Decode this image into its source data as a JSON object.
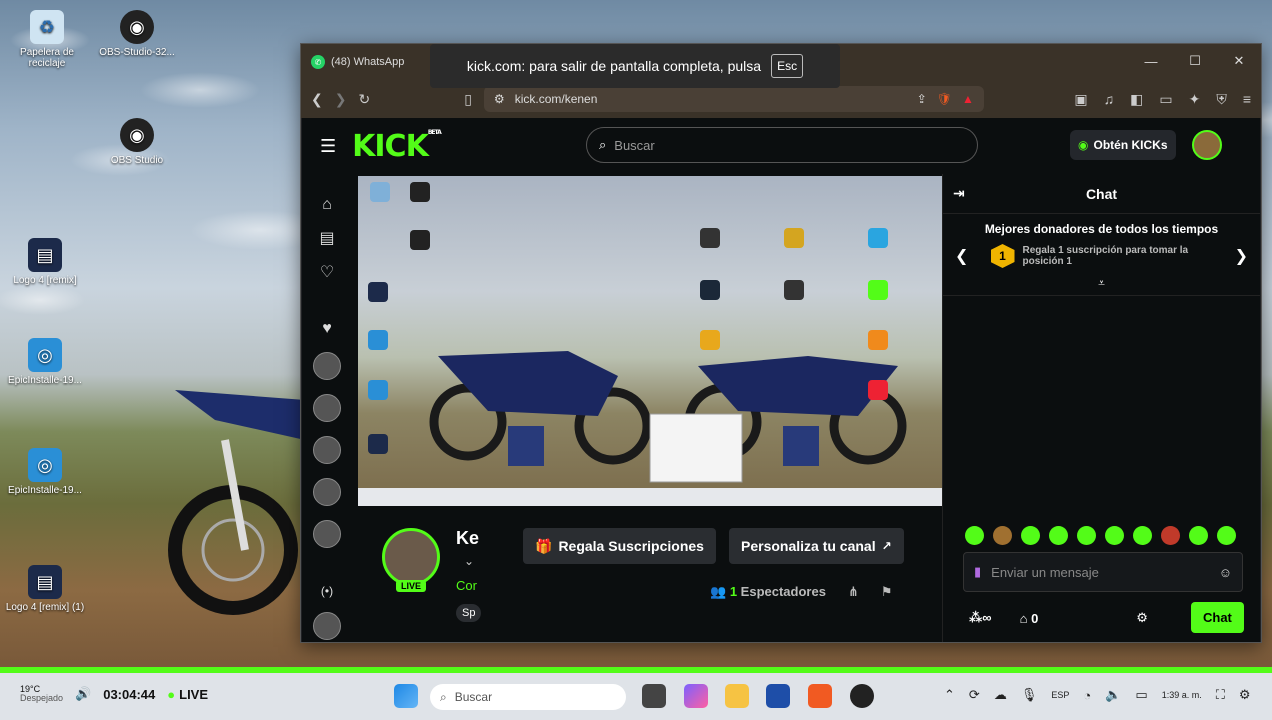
{
  "desktop": {
    "icons": [
      {
        "label": "Papelera de reciclaje",
        "icon": "recycle-bin-icon"
      },
      {
        "label": "OBS-Studio-32...",
        "icon": "obs-icon"
      },
      {
        "label": "OBS Studio",
        "icon": "obs-icon"
      },
      {
        "label": "Logo 4 [remix]",
        "icon": "video-file-icon"
      },
      {
        "label": "EpicInstalle-19...",
        "icon": "installer-icon"
      },
      {
        "label": "EpicInstalle-19...",
        "icon": "installer-icon"
      },
      {
        "label": "Logo 4 [remix] (1)",
        "icon": "video-file-icon"
      }
    ]
  },
  "browser": {
    "tab_title": "(48) WhatsApp",
    "tab_count_badge": "48",
    "url": "kick.com/kenen",
    "fullscreen_toast": "kick.com: para salir de pantalla completa, pulsa",
    "esc_key": "Esc"
  },
  "kick": {
    "logo": "KICK",
    "logo_badge": "BETA",
    "search_placeholder": "Buscar",
    "get_kicks": "Obtén KICKs",
    "streamer_name": "Ke",
    "category_prefix": "Cor",
    "tag_prefix": "Sp",
    "live": "LIVE",
    "gift_subs": "Regala Suscripciones",
    "customize": "Personaliza tu canal",
    "viewers_count": "1",
    "viewers_label": "Espectadores",
    "chat": {
      "title": "Chat",
      "top_donors": "Mejores donadores de todos los tiempos",
      "rank": "1",
      "donor_text": "Regala 1 suscripción para tomar la posición 1",
      "placeholder": "Enviar un mensaje",
      "kicks_count": "0",
      "send": "Chat"
    }
  },
  "taskbar": {
    "weather": "19°C",
    "weather_sub": "Despejado",
    "time_elapsed": "03:04:44",
    "live": "LIVE",
    "search": "Buscar",
    "lang": "ESP",
    "clock": "1:39 a. m."
  },
  "colors": {
    "kick_green": "#53fc18",
    "kick_bg": "#0b0e0f"
  }
}
